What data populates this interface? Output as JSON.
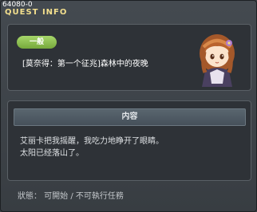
{
  "window": {
    "id_text": "64080-0",
    "title": "QUEST INFO"
  },
  "quest": {
    "tag": "一般",
    "name": "[莫奈得：第一个征兆]森林中的夜晚"
  },
  "content": {
    "header": "内容",
    "lines": [
      "艾丽卡把我摇醒，我吃力地睁开了眼睛。",
      "太阳已经落山了。"
    ]
  },
  "status": {
    "text": "狀態： 可開始 / 不可執行任務"
  },
  "colors": {
    "title": "#f3df8d",
    "tag": "#8cc34f",
    "panel": "#2e3237"
  },
  "icons": {
    "avatar": "npc-girl-avatar-icon"
  }
}
